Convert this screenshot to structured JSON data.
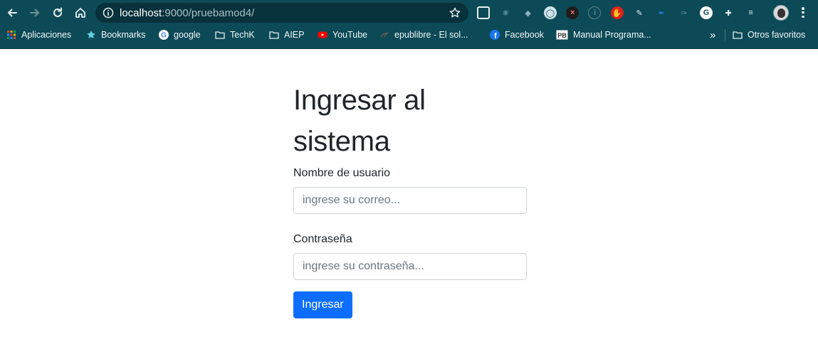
{
  "browser": {
    "url_host": "localhost",
    "url_path": ":9000/pruebamod4/",
    "accent": "#0d4a57",
    "extensions": [
      "apps-grid-icon",
      "react-devtools-icon",
      "dropbox-icon",
      "vpn-icon",
      "x-extension-icon",
      "info-extension-icon",
      "adblock-icon",
      "dropper-icon",
      "pen-icon",
      "feather-icon",
      "grammarly-icon",
      "puzzle-icon",
      "media-queue-icon"
    ]
  },
  "bookmarks": [
    {
      "label": "Aplicaciones",
      "icon": "apps-icon"
    },
    {
      "label": "Bookmarks",
      "icon": "star-icon"
    },
    {
      "label": "google",
      "icon": "google-icon"
    },
    {
      "label": "TechK",
      "icon": "folder-icon"
    },
    {
      "label": "AIEP",
      "icon": "folder-icon"
    },
    {
      "label": "YouTube",
      "icon": "youtube-icon"
    },
    {
      "label": "epublibre - El sol...",
      "icon": "epublibre-icon"
    },
    {
      "label": "Facebook",
      "icon": "facebook-icon"
    },
    {
      "label": "Manual Programa...",
      "icon": "pb-icon"
    }
  ],
  "bookmarks_more": "»",
  "other_bookmarks": "Otros favoritos",
  "form": {
    "title": "Ingresar al sistema",
    "username_label": "Nombre de usuario",
    "username_placeholder": "ingrese su correo...",
    "username_value": "",
    "password_label": "Contraseña",
    "password_placeholder": "ingrese su contraseña...",
    "password_value": "",
    "submit_label": "Ingresar",
    "button_color": "#0d6efd"
  }
}
